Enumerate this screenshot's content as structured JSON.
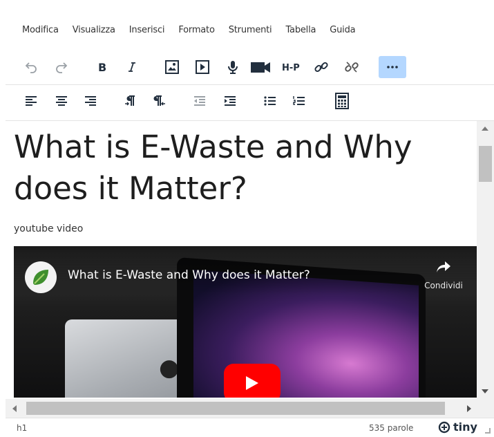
{
  "menubar": {
    "items": [
      "Modifica",
      "Visualizza",
      "Inserisci",
      "Formato",
      "Strumenti",
      "Tabella",
      "Guida"
    ]
  },
  "toolbar": {
    "row1": [
      "undo-icon",
      "redo-icon",
      "bold-icon",
      "italic-icon",
      "image-icon",
      "media-icon",
      "microphone-icon",
      "video-camera-icon",
      "h5p-icon",
      "link-icon",
      "unlink-icon",
      "more-icon"
    ],
    "h5p_label": "H-P",
    "row2": [
      "align-left-icon",
      "align-center-icon",
      "align-right-icon",
      "ltr-icon",
      "rtl-icon",
      "outdent-icon",
      "indent-icon",
      "bullet-list-icon",
      "numbered-list-icon",
      "calculator-icon"
    ],
    "active_button": "more-icon"
  },
  "content": {
    "title": "What is E-Waste and Why does it Matter?",
    "paragraph": "youtube video",
    "video": {
      "title": "What is E-Waste and Why does it Matter?",
      "share_label": "Condividi"
    }
  },
  "statusbar": {
    "path": "h1",
    "word_count": "535 parole",
    "brand": "tiny"
  },
  "colors": {
    "active_button_bg": "#b4d7ff",
    "play_button": "#ff0000",
    "text": "#222f3e"
  }
}
